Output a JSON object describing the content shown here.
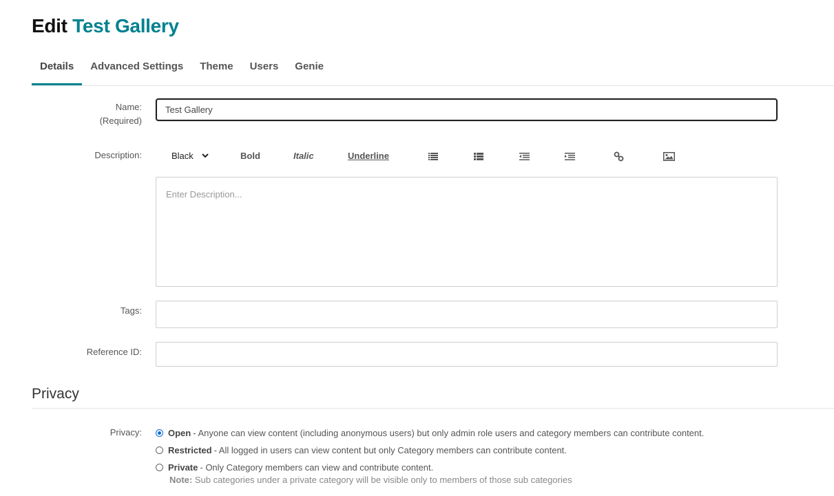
{
  "header": {
    "prefix": "Edit",
    "name": "Test Gallery"
  },
  "tabs": [
    {
      "label": "Details"
    },
    {
      "label": "Advanced Settings"
    },
    {
      "label": "Theme"
    },
    {
      "label": "Users"
    },
    {
      "label": "Genie"
    }
  ],
  "form": {
    "name_label": "Name:",
    "name_required": "(Required)",
    "name_value": "Test Gallery",
    "description_label": "Description:",
    "description_placeholder": "Enter Description...",
    "toolbar": {
      "color": "Black",
      "bold": "Bold",
      "italic": "Italic",
      "underline": "Underline"
    },
    "tags_label": "Tags:",
    "reference_label": "Reference ID:"
  },
  "privacy": {
    "section_title": "Privacy",
    "label": "Privacy:",
    "options": [
      {
        "title": "Open",
        "desc": " - Anyone can view content (including anonymous users) but only admin role users and category members can contribute content.",
        "checked": true
      },
      {
        "title": "Restricted",
        "desc": " - All logged in users can view content but only Category members can contribute content.",
        "checked": false
      },
      {
        "title": "Private",
        "desc": " - Only Category members can view and contribute content.",
        "checked": false
      }
    ],
    "note_label": "Note:",
    "note_text": " Sub categories under a private category will be visible only to members of those sub categories"
  },
  "colors": {
    "accent": "#00818f",
    "radio": "#0a6ad1"
  }
}
